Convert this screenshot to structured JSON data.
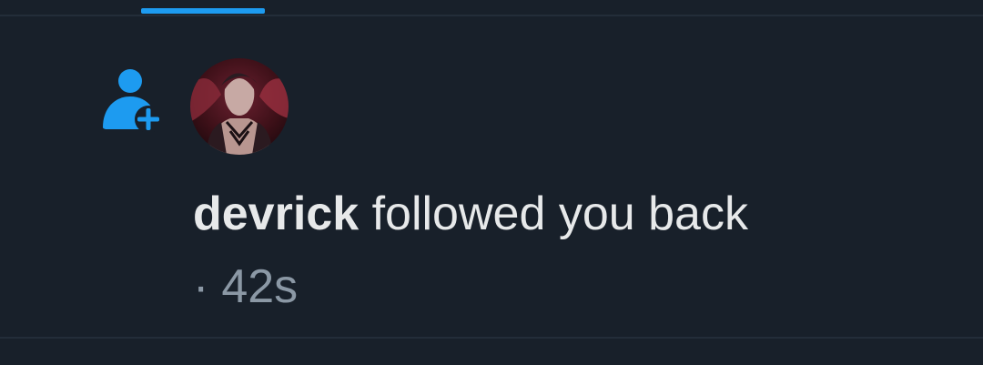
{
  "tabs": {
    "active_indicator_color": "#1d9bf0"
  },
  "notification": {
    "icon": "follow-icon",
    "avatar": "user-avatar",
    "username": "devrick",
    "action_text": " followed you back",
    "separator": "·",
    "time": "42s"
  },
  "colors": {
    "background": "#18202a",
    "accent": "#1d9bf0",
    "primary_text": "#e7e9ea",
    "secondary_text": "#8b98a5",
    "divider": "#232d39"
  }
}
